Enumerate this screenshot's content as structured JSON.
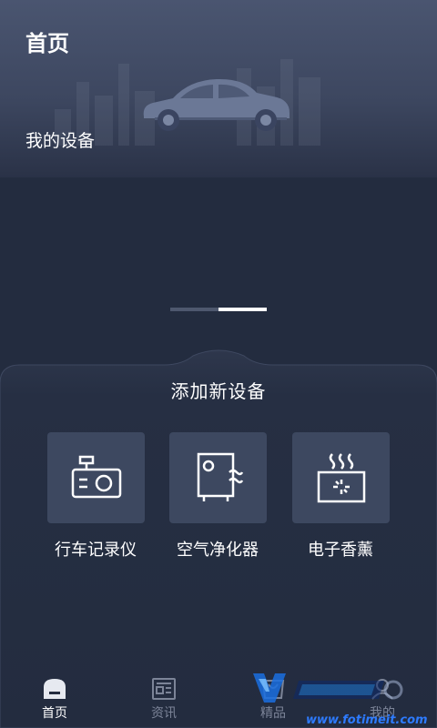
{
  "header": {
    "title": "首页"
  },
  "devices": {
    "section_title": "我的设备"
  },
  "add_device": {
    "title": "添加新设备",
    "items": [
      {
        "label": "行车记录仪",
        "icon": "dashcam-icon"
      },
      {
        "label": "空气净化器",
        "icon": "air-purifier-icon"
      },
      {
        "label": "电子香薰",
        "icon": "aroma-diffuser-icon"
      }
    ]
  },
  "tabbar": {
    "items": [
      {
        "label": "首页",
        "icon": "home-icon",
        "active": true
      },
      {
        "label": "资讯",
        "icon": "news-icon",
        "active": false
      },
      {
        "label": "精品",
        "icon": "shop-icon",
        "active": false
      },
      {
        "label": "我的",
        "icon": "profile-icon",
        "active": false
      }
    ]
  },
  "watermark": {
    "url": "www.fotimeit.com"
  },
  "colors": {
    "background": "#232c3f",
    "card": "#3d4860",
    "hero": "#4a5570",
    "accent": "#ffffff"
  },
  "carousel": {
    "pages": 2,
    "active_index": 1
  }
}
